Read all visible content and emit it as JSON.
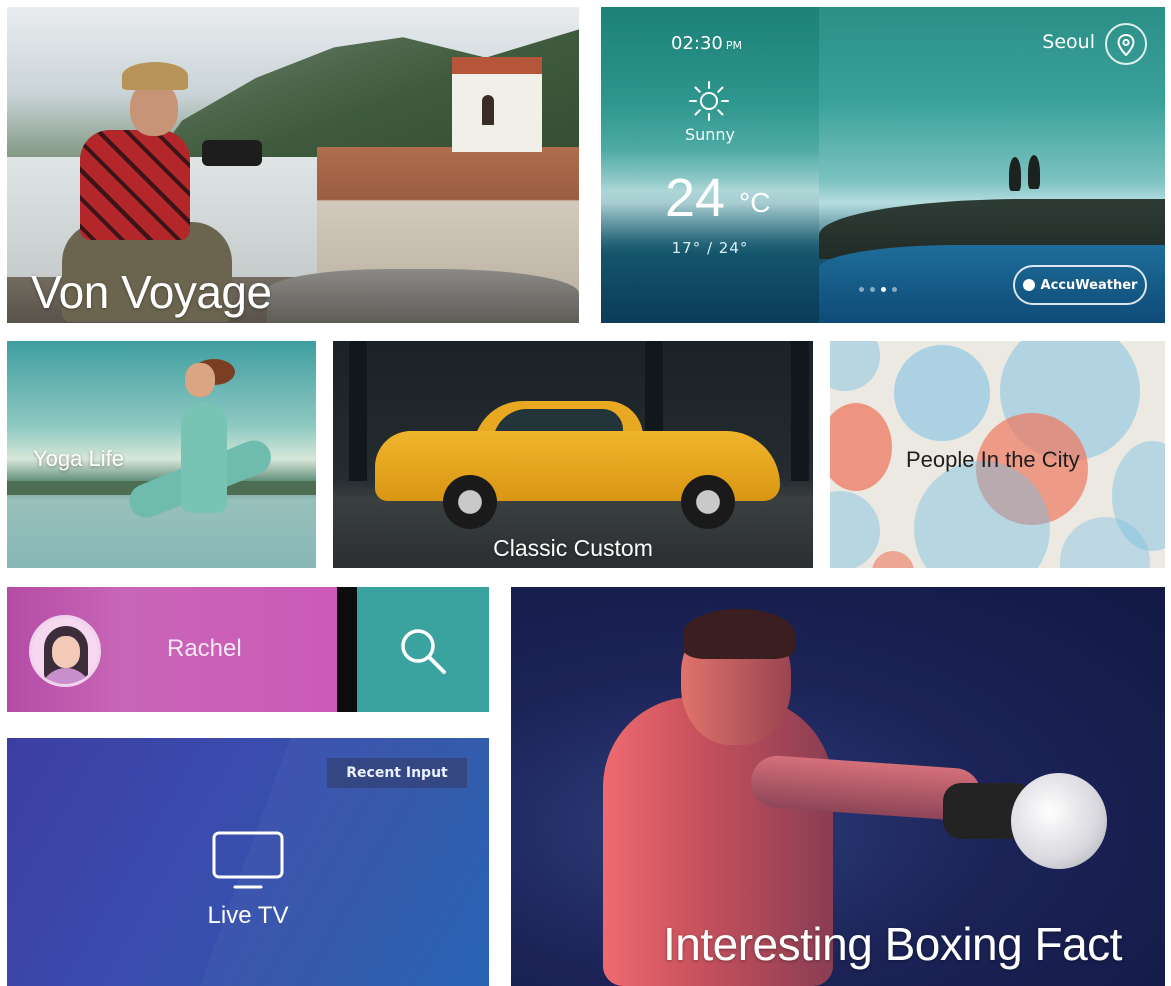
{
  "tiles": {
    "voyage": {
      "title": "Von Voyage"
    },
    "weather": {
      "time": "02:30",
      "ampm": "PM",
      "condition": "Sunny",
      "temperature": "24",
      "unit": "°C",
      "range": "17° / 24°",
      "city": "Seoul",
      "provider": "AccuWeather",
      "page_count": 4,
      "active_page": 3
    },
    "yoga": {
      "title": "Yoga Life"
    },
    "car": {
      "title": "Classic Custom"
    },
    "city": {
      "title": "People In the City"
    },
    "profile": {
      "name": "Rachel"
    },
    "live_tv": {
      "badge": "Recent Input",
      "title": "Live TV"
    },
    "boxing": {
      "title": "Interesting Boxing Fact"
    }
  },
  "icons": {
    "weather": "sun-icon",
    "location": "location-pin-icon",
    "provider": "accuweather-logo-icon",
    "search": "search-icon",
    "tv": "tv-icon",
    "avatar": "avatar-icon"
  },
  "colors": {
    "profile_tile": "#c45cb2",
    "search_tile": "#3ba39f",
    "live_tv_tile": "#3b4cae",
    "weather_tile": "#2b8f87"
  }
}
